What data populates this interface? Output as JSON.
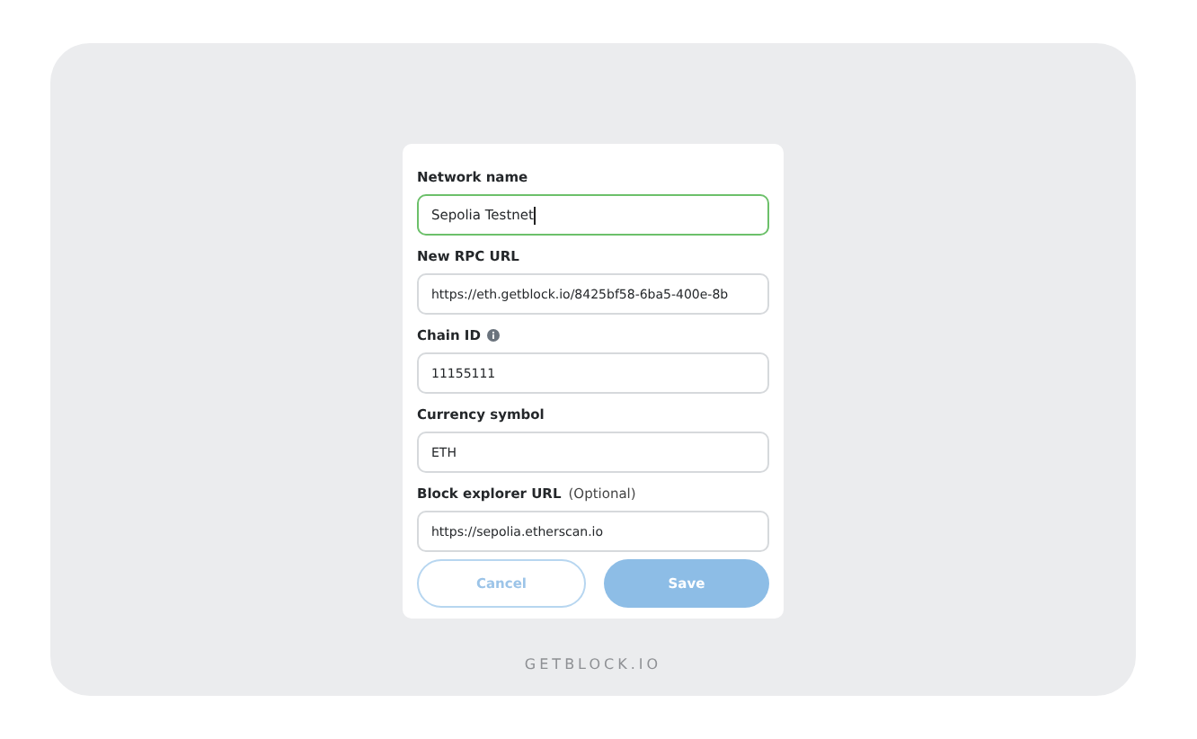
{
  "form": {
    "fields": [
      {
        "label": "Network name",
        "value": "Sepolia Testnet",
        "focused": true,
        "info": false
      },
      {
        "label": "New RPC URL",
        "value": "https://eth.getblock.io/8425bf58-6ba5-400e-8b",
        "focused": false,
        "info": false
      },
      {
        "label": "Chain ID",
        "value": "11155111",
        "focused": false,
        "info": true
      },
      {
        "label": "Currency symbol",
        "value": "ETH",
        "focused": false,
        "info": false
      },
      {
        "label": "Block explorer URL",
        "note": "(Optional)",
        "value": "https://sepolia.etherscan.io",
        "focused": false,
        "info": false
      }
    ],
    "buttons": [
      {
        "label": "Cancel",
        "kind": "secondary",
        "disabled": false
      },
      {
        "label": "Save",
        "kind": "primary",
        "disabled": true
      }
    ]
  },
  "footer": "GETBLOCK.IO"
}
